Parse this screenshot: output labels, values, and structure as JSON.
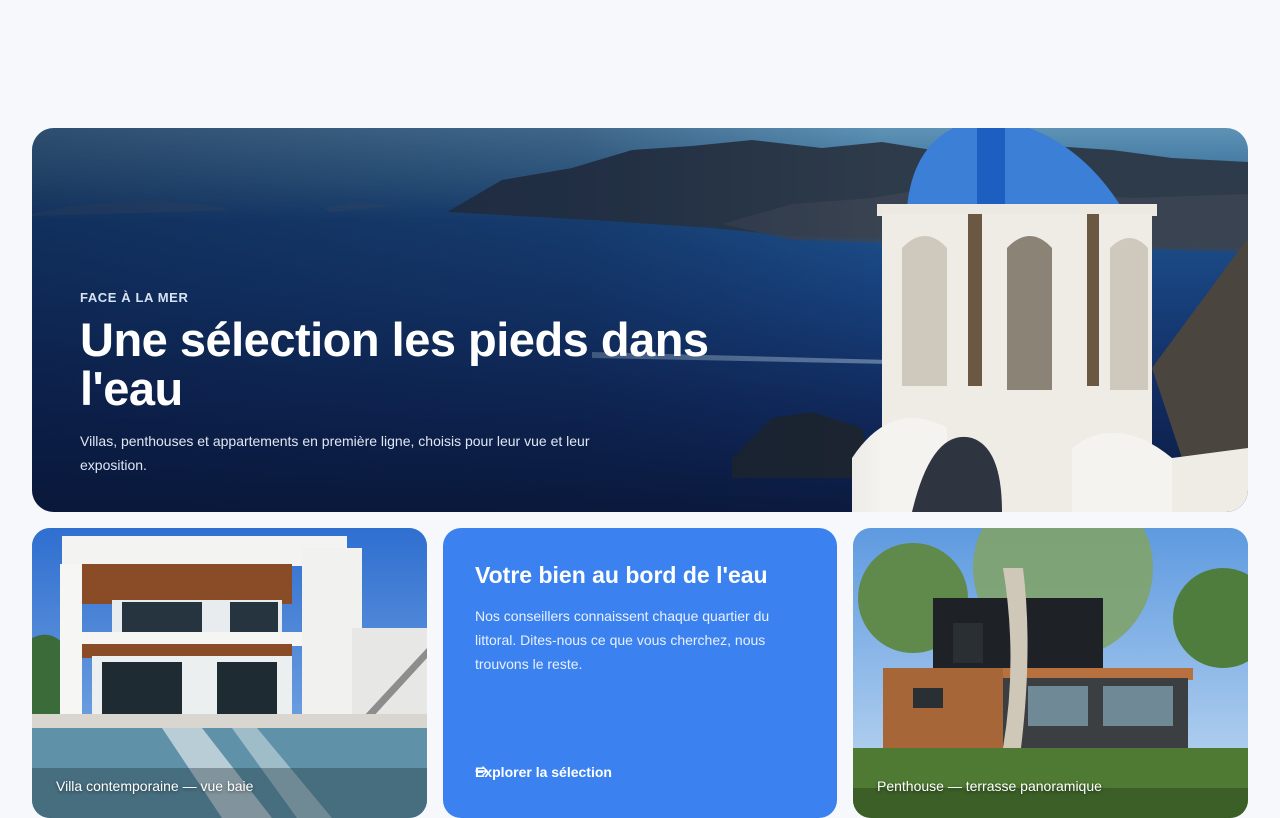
{
  "hero": {
    "eyebrow": "FACE À LA MER",
    "title": "Une sélection les pieds dans l'eau",
    "description": "Villas, penthouses et appartements en première ligne, choisis pour leur vue et leur exposition."
  },
  "cards": {
    "villa_caption": "Villa contemporaine — vue baie",
    "cta": {
      "title": "Votre bien au bord de l'eau",
      "text": "Nos conseillers connaissent chaque quartier du littoral. Dites-nous ce que vous cherchez, nous trouvons le reste.",
      "link_label": "Explorer la sélection",
      "link_icon": "arrow-right-icon"
    },
    "penthouse_caption": "Penthouse — terrasse panoramique"
  },
  "colors": {
    "accent": "#3b82f0",
    "background": "#f6f8fb"
  }
}
